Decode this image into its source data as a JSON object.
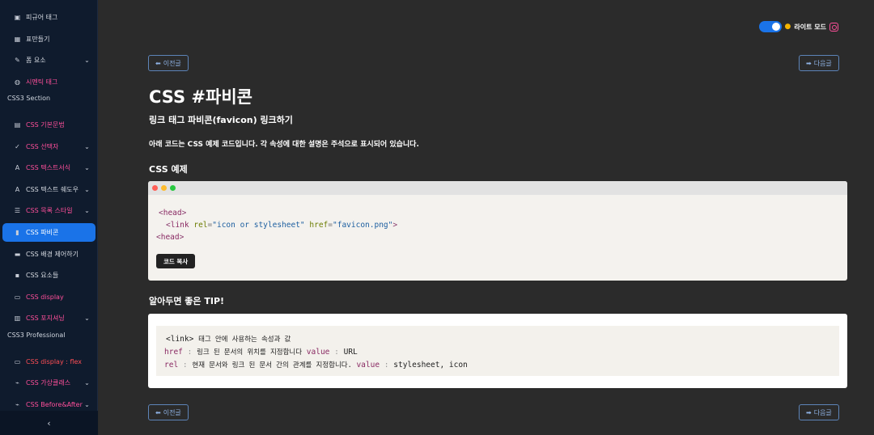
{
  "sidebar": {
    "items": [
      {
        "label": "피규어 태그",
        "icon": "figure-icon",
        "color": "default",
        "chev": false
      },
      {
        "label": "표만들기",
        "icon": "table-icon",
        "color": "default",
        "chev": false
      },
      {
        "label": "폼 요소",
        "icon": "form-edit-icon",
        "color": "default",
        "chev": true
      },
      {
        "label": "시멘틱 태그",
        "icon": "globe-icon",
        "color": "pink",
        "chev": false
      }
    ],
    "section_css3": "CSS3 Section",
    "items2": [
      {
        "label": "CSS 기본문법",
        "icon": "document-icon",
        "color": "pink",
        "chev": false
      },
      {
        "label": "CSS 선택자",
        "icon": "check-icon",
        "color": "pink",
        "chev": true
      },
      {
        "label": "CSS 텍스트서식",
        "icon": "text-format-icon",
        "color": "pink",
        "chev": true
      },
      {
        "label": "CSS 텍스트 쉐도우",
        "icon": "text-shadow-icon",
        "color": "default",
        "chev": true
      },
      {
        "label": "CSS 목록 스타일",
        "icon": "list-icon",
        "color": "pink",
        "chev": true
      },
      {
        "label": "CSS 파비콘",
        "icon": "favicon-icon",
        "color": "active",
        "chev": false
      },
      {
        "label": "CSS 배경 제어하기",
        "icon": "background-icon",
        "color": "default",
        "chev": false
      },
      {
        "label": "CSS 요소들",
        "icon": "element-icon",
        "color": "default",
        "chev": false
      },
      {
        "label": "CSS display",
        "icon": "display-icon",
        "color": "pink",
        "chev": false
      },
      {
        "label": "CSS 포지셔닝",
        "icon": "position-icon",
        "color": "pink",
        "chev": true
      }
    ],
    "section_pro": "CSS3 Professional",
    "items3": [
      {
        "label": "CSS display : flex",
        "icon": "flex-icon",
        "color": "red",
        "chev": false
      },
      {
        "label": "CSS 가상클래스",
        "icon": "pseudo-class-icon",
        "color": "pink",
        "chev": true
      },
      {
        "label": "CSS Before&After",
        "icon": "before-after-icon",
        "color": "pink",
        "chev": true
      }
    ],
    "collapse_glyph": "‹"
  },
  "topbar": {
    "mode_label": "라이트 모드",
    "sun_glyph": "●"
  },
  "nav": {
    "prev_label": "이전글",
    "next_label": "다음글",
    "prev_arrow": "⬅",
    "next_arrow": "➡"
  },
  "content": {
    "title": "CSS #파비콘",
    "subtitle": "링크 태그 파비콘(favicon) 링크하기",
    "description": "아래 코드는 CSS 예제 코드입니다. 각 속성에 대한 설명은 주석으로 표시되어 있습니다.",
    "example_heading": "CSS 예제",
    "tip_heading": "알아두면 좋은 TIP!"
  },
  "code": {
    "line1_tag": "head",
    "line2_tag": "link",
    "line2_attr1": "rel",
    "line2_val1": "\"icon or stylesheet\"",
    "line2_attr2": "href",
    "line2_val2": "\"favicon.png\"",
    "line3_tag": "head",
    "copy_label": "코드 복사"
  },
  "tip": {
    "line1_code": "<link>",
    "line1_text": "태그 안에 사용하는 속성과 값",
    "line2_key": "href",
    "line2_text": "링크 된 문서의 위치를 지정합니다",
    "line2_value_kw": "value",
    "line2_value": "URL",
    "line3_key": "rel",
    "line3_text": "현재 문서와 링크 된 문서 간의 관계를 지정합니다.",
    "line3_value_kw": "value",
    "line3_value": "stylesheet, icon"
  },
  "colors": {
    "sidebar_bg": "#0f1b2d",
    "accent": "#1a73e8",
    "pink": "#ff4f9a",
    "main_bg": "#2b2b2b"
  }
}
